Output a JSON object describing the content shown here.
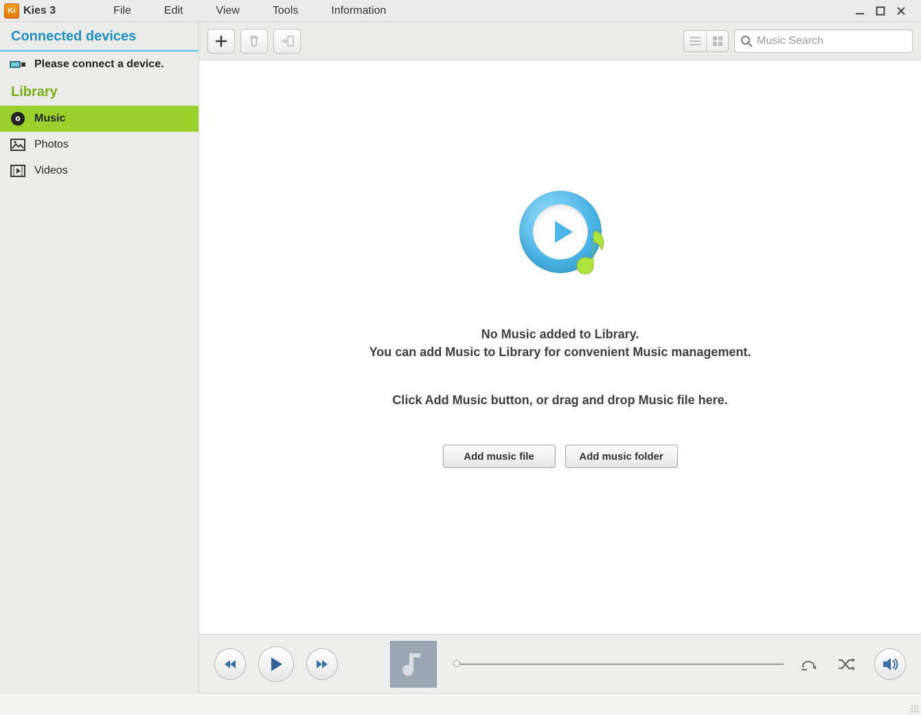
{
  "app": {
    "title": "Kies 3"
  },
  "menu": {
    "items": [
      "File",
      "Edit",
      "View",
      "Tools",
      "Information"
    ]
  },
  "sidebar": {
    "devices_header": "Connected devices",
    "connect_prompt": "Please connect a device.",
    "library_header": "Library",
    "items": [
      {
        "label": "Music",
        "active": true
      },
      {
        "label": "Photos",
        "active": false
      },
      {
        "label": "Videos",
        "active": false
      }
    ]
  },
  "toolbar": {
    "search_placeholder": "Music Search"
  },
  "empty": {
    "line1": "No Music added to Library.",
    "line2": "You can add Music to Library for convenient Music management.",
    "line3": "Click Add Music button, or drag and drop Music file here.",
    "btn_file": "Add music file",
    "btn_folder": "Add music folder"
  }
}
